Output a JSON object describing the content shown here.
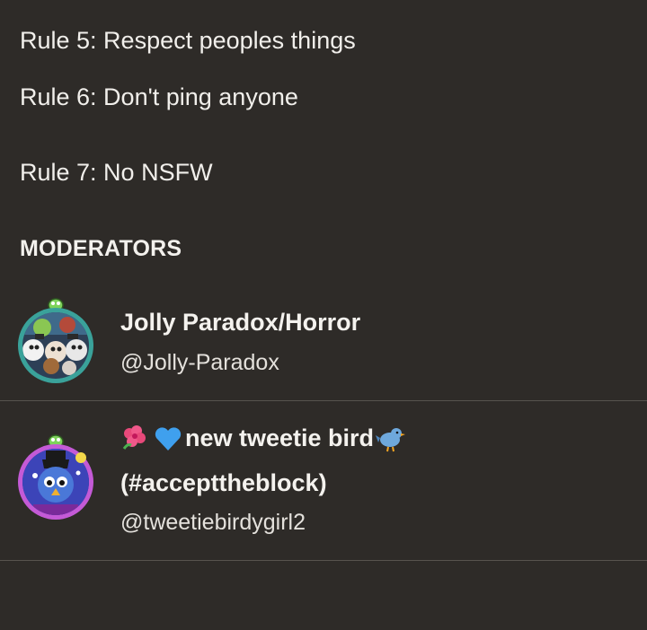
{
  "rules": {
    "rule5": "Rule 5: Respect peoples things",
    "rule6": "Rule 6: Don't ping anyone",
    "rule7": "Rule 7: No NSFW"
  },
  "moderators_section": {
    "title": "MODERATORS",
    "items": [
      {
        "display_name": "Jolly Paradox/Horror",
        "handle": "@Jolly-Paradox",
        "avatar_icon": "character-group-avatar"
      },
      {
        "display_name_line1": "new tweetie bird",
        "display_name_line2": "(#accepttheblock)",
        "handle": "@tweetiebirdygirl2",
        "avatar_icon": "blue-character-avatar",
        "name_emojis": [
          "hibiscus-icon",
          "blue-heart-icon",
          "bird-icon"
        ]
      }
    ]
  },
  "colors": {
    "background": "#2e2b28",
    "text": "#f2f0ec",
    "divider": "#57534e"
  }
}
